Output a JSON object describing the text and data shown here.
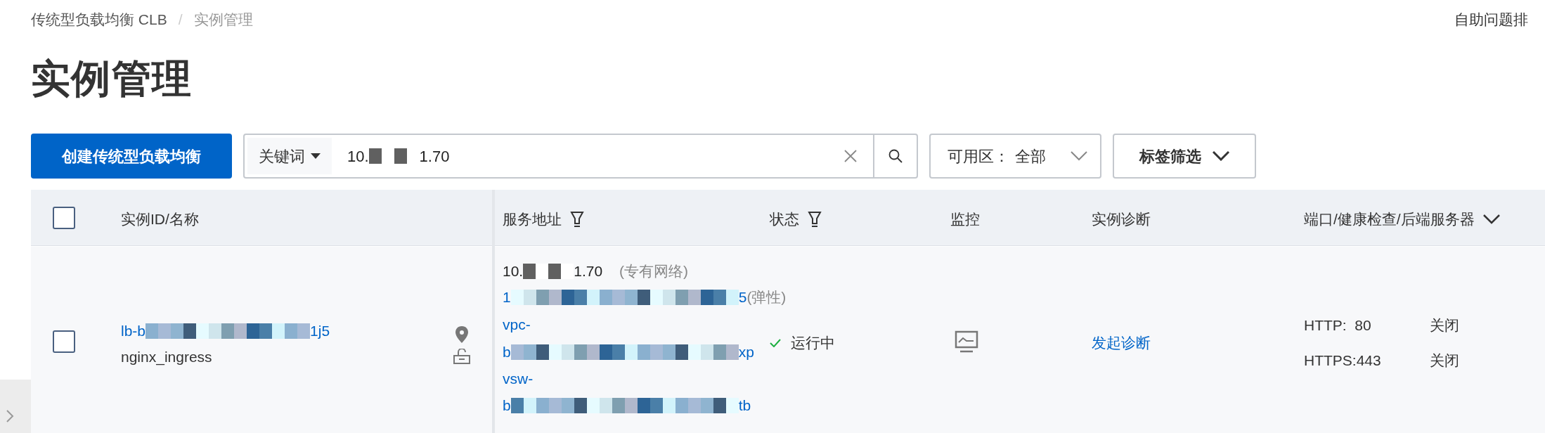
{
  "breadcrumb_separator": "/",
  "breadcrumb": [
    {
      "label": "传统型负载均衡 CLB",
      "current": false
    },
    {
      "label": "实例管理",
      "current": true
    }
  ],
  "help_link": "自助问题排",
  "title": "实例管理",
  "toolbar": {
    "create_button": "创建传统型负载均衡",
    "search": {
      "key": "关键词",
      "value_start": "10.",
      "value_end": "1.70"
    },
    "zone": {
      "label": "可用区：",
      "value": "全部"
    },
    "tag_filter": "标签筛选"
  },
  "table": {
    "select_all_checked": false,
    "columns": [
      {
        "label": "实例ID/名称",
        "kind": "plain"
      },
      {
        "label": "服务地址",
        "kind": "filter"
      },
      {
        "label": "状态",
        "kind": "filter"
      },
      {
        "label": "监控",
        "kind": "plain"
      },
      {
        "label": "实例诊断",
        "kind": "plain"
      },
      {
        "label": "端口/健康检查/后端服务器",
        "kind": "menu"
      }
    ],
    "rows": [
      {
        "checked": false,
        "id_start": "lb-b",
        "id_end": "1j5",
        "name": "nginx_ingress",
        "addresses": [
          {
            "kind": "ip",
            "start": "10.",
            "end": "1.70",
            "note": "(专有网络)"
          },
          {
            "kind": "ip",
            "start": "1",
            "end": "5",
            "note": "(弹性)"
          },
          {
            "kind": "net",
            "start": "vpc-"
          },
          {
            "kind": "net",
            "start": "b",
            "end": "xp"
          },
          {
            "kind": "net",
            "start": "vsw-"
          },
          {
            "kind": "net",
            "start": "b",
            "end": "tb"
          }
        ],
        "status": "运行中",
        "diagnose": "发起诊断",
        "ports": [
          {
            "protocol": "HTTP:  80",
            "health": "关闭"
          },
          {
            "protocol": "HTTPS:443",
            "health": "关闭"
          }
        ]
      }
    ]
  }
}
